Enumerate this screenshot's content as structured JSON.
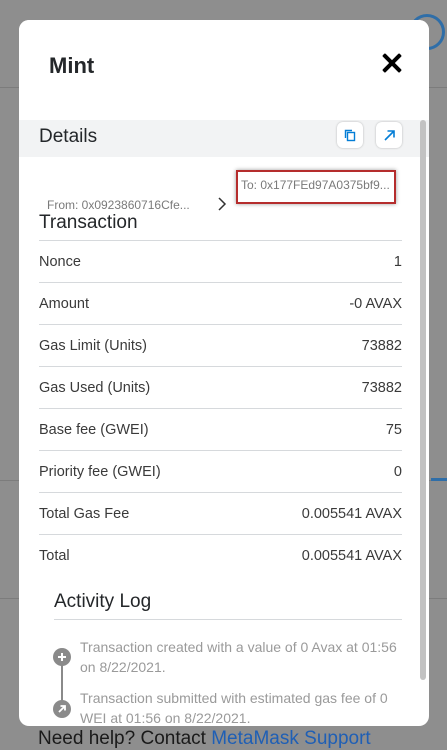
{
  "modal": {
    "title": "Mint"
  },
  "details": {
    "label": "Details",
    "from": "From: 0x0923860716Cfe...",
    "to": "To: 0x177FEd97A0375bf9..."
  },
  "transaction": {
    "title": "Transaction",
    "rows": [
      {
        "label": "Nonce",
        "value": "1"
      },
      {
        "label": "Amount",
        "value": "-0 AVAX"
      },
      {
        "label": "Gas Limit (Units)",
        "value": "73882"
      },
      {
        "label": "Gas Used (Units)",
        "value": "73882"
      },
      {
        "label": "Base fee (GWEI)",
        "value": "75"
      },
      {
        "label": "Priority fee (GWEI)",
        "value": "0"
      },
      {
        "label": "Total Gas Fee",
        "value": "0.005541 AVAX"
      },
      {
        "label": "Total",
        "value": "0.005541 AVAX"
      }
    ]
  },
  "activity": {
    "title": "Activity Log",
    "entries": [
      {
        "text": "Transaction created with a value of 0 Avax at 01:56 on 8/22/2021.",
        "icon": "plus-circle-icon"
      },
      {
        "text": "Transaction submitted with estimated gas fee of 0 WEI at 01:56 on 8/22/2021.",
        "icon": "arrow-up-right-circle-icon"
      }
    ]
  },
  "background": {
    "help_prefix": "Need help? Contact ",
    "help_link": "MetaMask Support"
  },
  "colors": {
    "accent": "#037dd6",
    "highlight_border": "#b52d2d"
  }
}
